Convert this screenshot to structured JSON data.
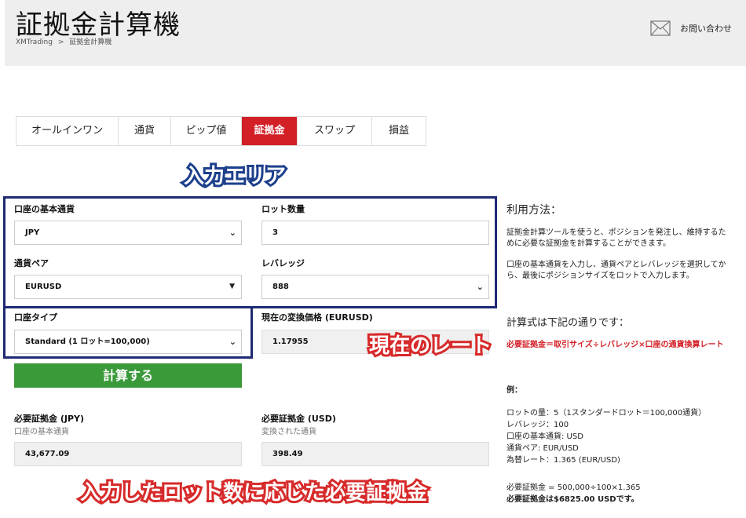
{
  "header": {
    "title": "証拠金計算機",
    "breadcrumb": [
      "XMTrading",
      ">",
      "証拠金計算機"
    ],
    "contact_label": "お問い合わせ"
  },
  "tabs": [
    {
      "label": "オールインワン"
    },
    {
      "label": "通貨"
    },
    {
      "label": "ピップ値"
    },
    {
      "label": "証拠金",
      "active": true
    },
    {
      "label": "スワップ"
    },
    {
      "label": "損益"
    }
  ],
  "annotations": {
    "input_area": "入力エリア",
    "current_rate": "現在のレート",
    "required_margin": "入力したロット数に応じた必要証拠金"
  },
  "form": {
    "account_currency_label": "口座の基本通貨",
    "account_currency_value": "JPY",
    "lot_label": "ロット数量",
    "lot_value": "3",
    "pair_label": "通貨ペア",
    "pair_value": "EURUSD",
    "leverage_label": "レバレッジ",
    "leverage_value": "888",
    "account_type_label": "口座タイプ",
    "account_type_value": "Standard (1 ロット=100,000)",
    "rate_label": "現在の変換価格 (EURUSD)",
    "rate_value": "1.17955",
    "calc_button": "計算する"
  },
  "results": {
    "jpy_label": "必要証拠金 (JPY)",
    "jpy_sub": "口座の基本通貨",
    "jpy_value": "43,677.09",
    "usd_label": "必要証拠金 (USD)",
    "usd_sub": "変換された通貨",
    "usd_value": "398.49"
  },
  "usage": {
    "title": "利用方法：",
    "p1": "証拠金計算ツールを使うと、ポジションを発注し、維持するために必要な証拠金を計算することができます。",
    "p2": "口座の基本通貨を入力し、通貨ペアとレバレッジを選択してから、最後にポジションサイズをロットで入力します。",
    "formula_title": "計算式は下記の通りです：",
    "formula": "必要証拠金＝取引サイズ÷レバレッジ×口座の通貨換算レート",
    "example_title": "例：",
    "example_lines": [
      "ロットの量：5（1スタンダードロット＝100,000通貨）",
      "レバレッジ：100",
      "口座の基本通貨: USD",
      "通貨ペア: EUR/USD",
      "為替レート：1.365 (EUR/USD)"
    ],
    "calc_line": "必要証拠金 = 500,000÷100×1.365",
    "result_line": "必要証拠金は$6825.00 USDです。"
  },
  "colors": {
    "accent_red": "#d32027",
    "button_green": "#3a9a3a",
    "annotation_navy": "#1f2a73"
  }
}
